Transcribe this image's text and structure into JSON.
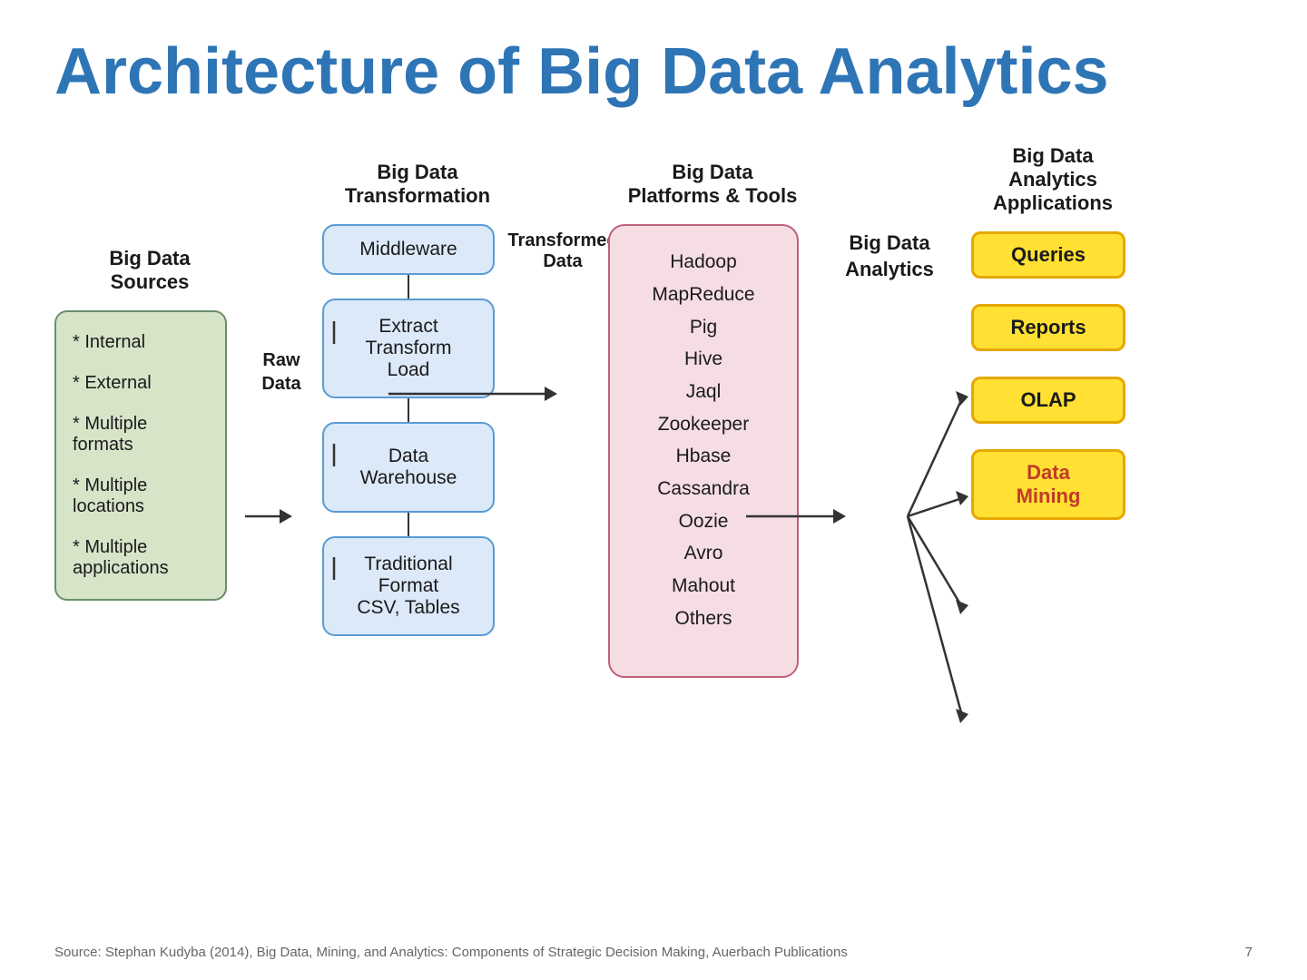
{
  "title": "Architecture of Big Data Analytics",
  "columns": {
    "sources": {
      "header": "Big Data\nSources",
      "items": [
        "* Internal",
        "* External",
        "* Multiple\nformats",
        "* Multiple\nlocations",
        "* Multiple\napplications"
      ]
    },
    "raw_data": "Raw\nData",
    "transformation": {
      "header": "Big Data\nTransformation",
      "boxes": [
        "Middleware",
        "Extract\nTransform\nLoad",
        "Data\nWarehouse",
        "Traditional\nFormat\nCSV, Tables"
      ]
    },
    "transformed_data": "Transformed\nData",
    "platforms": {
      "header": "Big Data\nPlatforms & Tools",
      "items": [
        "Hadoop",
        "MapReduce",
        "Pig",
        "Hive",
        "Jaql",
        "Zookeeper",
        "Hbase",
        "Cassandra",
        "Oozie",
        "Avro",
        "Mahout",
        "Others"
      ]
    },
    "analytics": {
      "label": "Big Data\nAnalytics"
    },
    "applications": {
      "header": "Big Data\nAnalytics\nApplications",
      "boxes": [
        "Queries",
        "Reports",
        "OLAP",
        "Data\nMining"
      ]
    }
  },
  "footer": {
    "source": "Source: Stephan Kudyba (2014), Big Data, Mining, and Analytics: Components of Strategic Decision Making, Auerbach Publications",
    "page": "7"
  }
}
